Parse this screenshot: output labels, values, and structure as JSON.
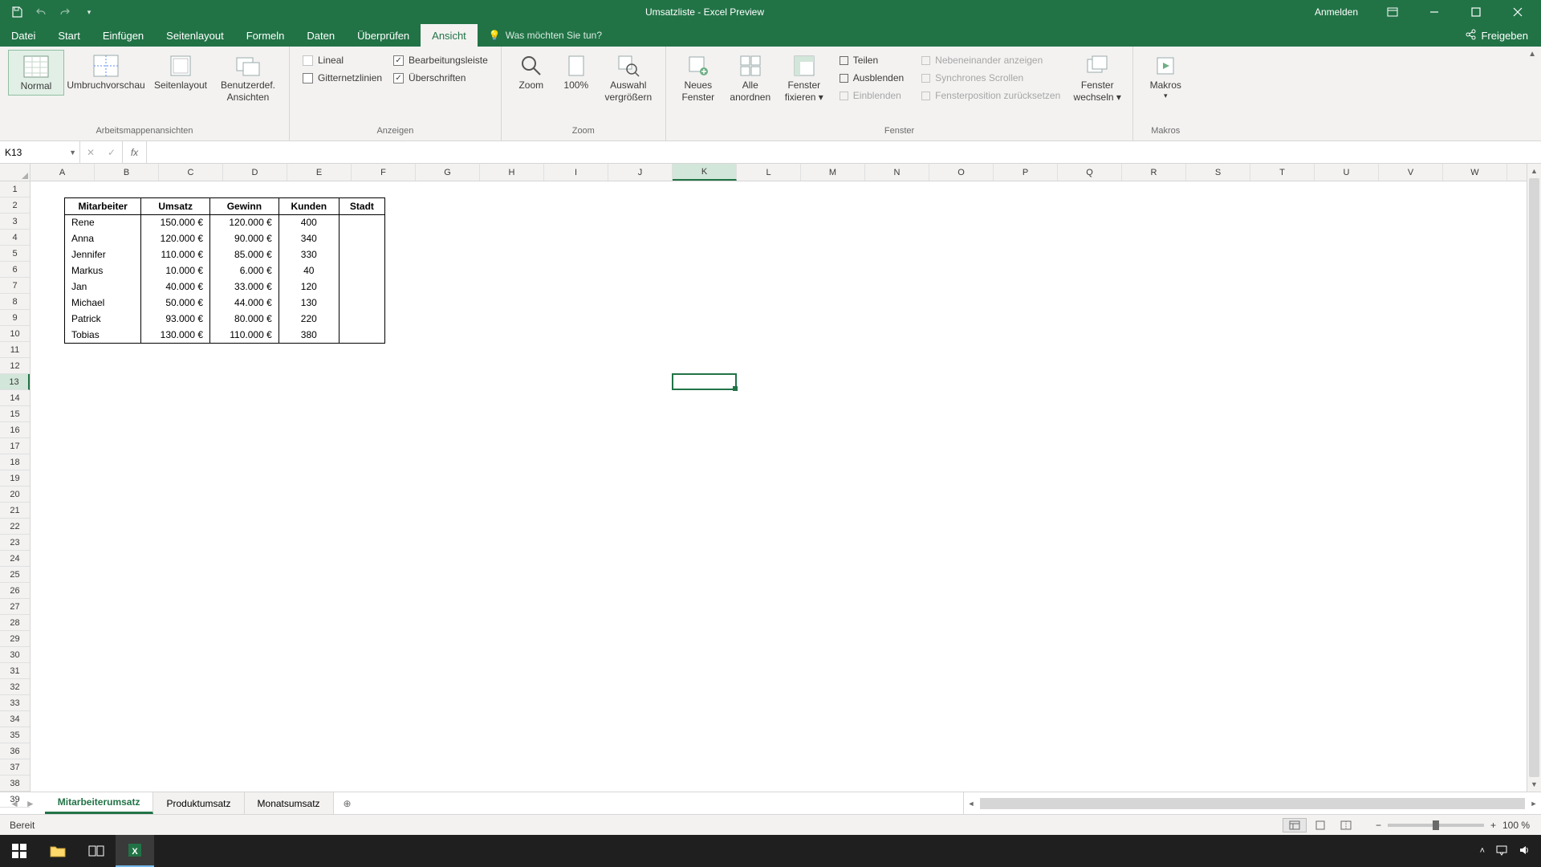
{
  "title": "Umsatzliste  -  Excel Preview",
  "signin": "Anmelden",
  "tabs": {
    "file": "Datei",
    "home": "Start",
    "insert": "Einfügen",
    "pagelayout": "Seitenlayout",
    "formulas": "Formeln",
    "data": "Daten",
    "review": "Überprüfen",
    "view": "Ansicht",
    "tellme": "Was möchten Sie tun?",
    "share": "Freigeben"
  },
  "ribbon": {
    "views": {
      "normal": "Normal",
      "pagebreak": "Umbruchvorschau",
      "pagelayout": "Seitenlayout",
      "custom1": "Benutzerdef.",
      "custom2": "Ansichten",
      "group": "Arbeitsmappenansichten"
    },
    "show": {
      "ruler": "Lineal",
      "gridlines": "Gitternetzlinien",
      "formulabar": "Bearbeitungsleiste",
      "headings": "Überschriften",
      "group": "Anzeigen"
    },
    "zoom": {
      "zoom": "Zoom",
      "p100": "100%",
      "sel1": "Auswahl",
      "sel2": "vergrößern",
      "group": "Zoom"
    },
    "window": {
      "new1": "Neues",
      "new2": "Fenster",
      "arr1": "Alle",
      "arr2": "anordnen",
      "freeze1": "Fenster",
      "freeze2": "fixieren",
      "split": "Teilen",
      "hide": "Ausblenden",
      "unhide": "Einblenden",
      "side": "Nebeneinander anzeigen",
      "sync": "Synchrones Scrollen",
      "reset": "Fensterposition zurücksetzen",
      "switch1": "Fenster",
      "switch2": "wechseln",
      "group": "Fenster"
    },
    "macros": {
      "label": "Makros",
      "group": "Makros"
    }
  },
  "namebox": "K13",
  "columns": [
    "A",
    "B",
    "C",
    "D",
    "E",
    "F",
    "G",
    "H",
    "I",
    "J",
    "K",
    "L",
    "M",
    "N",
    "O",
    "P",
    "Q",
    "R",
    "S",
    "T",
    "U",
    "V",
    "W"
  ],
  "table": {
    "headers": [
      "Mitarbeiter",
      "Umsatz",
      "Gewinn",
      "Kunden",
      "Stadt"
    ],
    "rows": [
      [
        "Rene",
        "150.000 €",
        "120.000 €",
        "400",
        ""
      ],
      [
        "Anna",
        "120.000 €",
        "90.000 €",
        "340",
        ""
      ],
      [
        "Jennifer",
        "110.000 €",
        "85.000 €",
        "330",
        ""
      ],
      [
        "Markus",
        "10.000 €",
        "6.000 €",
        "40",
        ""
      ],
      [
        "Jan",
        "40.000 €",
        "33.000 €",
        "120",
        ""
      ],
      [
        "Michael",
        "50.000 €",
        "44.000 €",
        "130",
        ""
      ],
      [
        "Patrick",
        "93.000 €",
        "80.000 €",
        "220",
        ""
      ],
      [
        "Tobias",
        "130.000 €",
        "110.000 €",
        "380",
        ""
      ]
    ]
  },
  "sheets": {
    "s1": "Mitarbeiterumsatz",
    "s2": "Produktumsatz",
    "s3": "Monatsumsatz"
  },
  "status": {
    "ready": "Bereit",
    "zoom": "100 %"
  },
  "selected": {
    "col_index": 10,
    "row": 13
  }
}
